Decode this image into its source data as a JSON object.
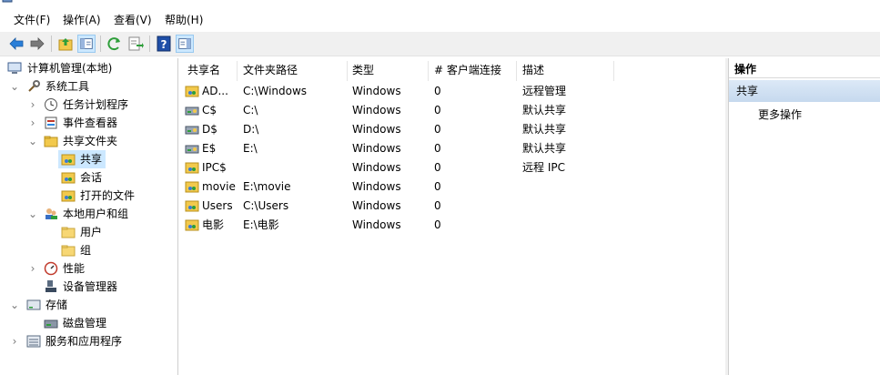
{
  "menubar": [
    {
      "label": "文件(F)",
      "name": "menu-file"
    },
    {
      "label": "操作(A)",
      "name": "menu-action"
    },
    {
      "label": "查看(V)",
      "name": "menu-view"
    },
    {
      "label": "帮助(H)",
      "name": "menu-help"
    }
  ],
  "toolbar": {
    "buttons": [
      "back-arrow-icon",
      "forward-arrow-icon",
      "up-folder-icon",
      "show-hide-tree-icon",
      "refresh-icon",
      "export-list-icon",
      "help-icon",
      "show-hide-action-pane-icon"
    ]
  },
  "tree": {
    "root": "计算机管理(本地)",
    "system_tools": "系统工具",
    "task_scheduler": "任务计划程序",
    "event_viewer": "事件查看器",
    "shared_folders": "共享文件夹",
    "shares": "共享",
    "sessions": "会话",
    "open_files": "打开的文件",
    "local_users_groups": "本地用户和组",
    "users": "用户",
    "groups": "组",
    "performance": "性能",
    "device_manager": "设备管理器",
    "storage": "存储",
    "disk_management": "磁盘管理",
    "services_apps": "服务和应用程序"
  },
  "list": {
    "columns": [
      "共享名",
      "文件夹路径",
      "类型",
      "# 客户端连接",
      "描述"
    ],
    "rows": [
      {
        "name": "AD...",
        "path": "C:\\Windows",
        "type": "Windows",
        "clients": "0",
        "desc": "远程管理",
        "icon": "share-folder-icon"
      },
      {
        "name": "C$",
        "path": "C:\\",
        "type": "Windows",
        "clients": "0",
        "desc": "默认共享",
        "icon": "share-drive-icon"
      },
      {
        "name": "D$",
        "path": "D:\\",
        "type": "Windows",
        "clients": "0",
        "desc": "默认共享",
        "icon": "share-drive-icon"
      },
      {
        "name": "E$",
        "path": "E:\\",
        "type": "Windows",
        "clients": "0",
        "desc": "默认共享",
        "icon": "share-drive-icon"
      },
      {
        "name": "IPC$",
        "path": "",
        "type": "Windows",
        "clients": "0",
        "desc": "远程 IPC",
        "icon": "share-folder-icon"
      },
      {
        "name": "movie",
        "path": "E:\\movie",
        "type": "Windows",
        "clients": "0",
        "desc": "",
        "icon": "share-folder-icon"
      },
      {
        "name": "Users",
        "path": "C:\\Users",
        "type": "Windows",
        "clients": "0",
        "desc": "",
        "icon": "share-folder-icon"
      },
      {
        "name": "电影",
        "path": "E:\\电影",
        "type": "Windows",
        "clients": "0",
        "desc": "",
        "icon": "share-folder-icon"
      }
    ]
  },
  "actions": {
    "header": "操作",
    "section": "共享",
    "more": "更多操作"
  },
  "colors": {
    "selection": "#cce8ff",
    "toolbar_bg": "#f0f0f0",
    "action_section": "#c6d9ee"
  }
}
